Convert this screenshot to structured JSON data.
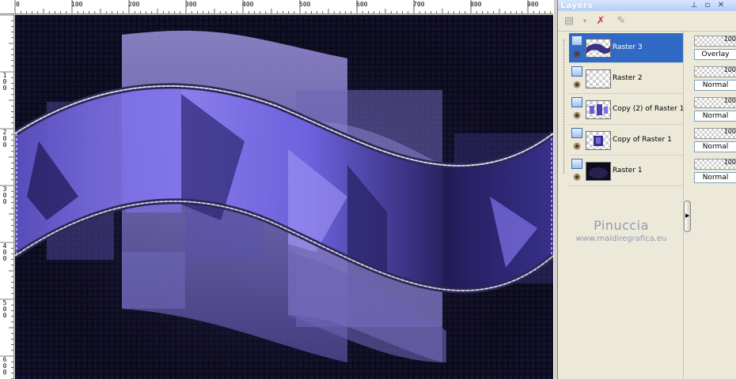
{
  "ruler": {
    "h_labels": [
      "0",
      "100",
      "200",
      "300",
      "400",
      "500",
      "600",
      "700",
      "800",
      "900"
    ],
    "v_labels": [
      "1\n0\n0",
      "2\n0\n0",
      "3\n0\n0",
      "4\n0\n0",
      "5\n0\n0",
      "6\n0\n0"
    ]
  },
  "panel": {
    "title": "Layers",
    "pin_icon": "pin-icon",
    "restore_icon": "restore-icon",
    "close_icon": "close-icon"
  },
  "toolbar": {
    "new_layer_icon": "new-layer-icon",
    "delete_icon": "delete-layer-icon",
    "edit_icon": "edit-selection-icon"
  },
  "layers": [
    {
      "name": "Raster 3",
      "opacity": "100",
      "blend": "Overlay",
      "selected": true
    },
    {
      "name": "Raster 2",
      "opacity": "100",
      "blend": "Normal",
      "selected": false
    },
    {
      "name": "Copy (2) of Raster 1",
      "opacity": "100",
      "blend": "Normal",
      "selected": false
    },
    {
      "name": "Copy of Raster 1",
      "opacity": "100",
      "blend": "Normal",
      "selected": false
    },
    {
      "name": "Raster 1",
      "opacity": "100",
      "blend": "Normal",
      "selected": false
    }
  ],
  "watermark": {
    "name": "Pinuccia",
    "url": "www.maidiregrafica.eu"
  },
  "colors": {
    "accent_purple": "#7b6fe0",
    "selection_blue": "#316ac5",
    "canvas_bg": "#07060f"
  }
}
